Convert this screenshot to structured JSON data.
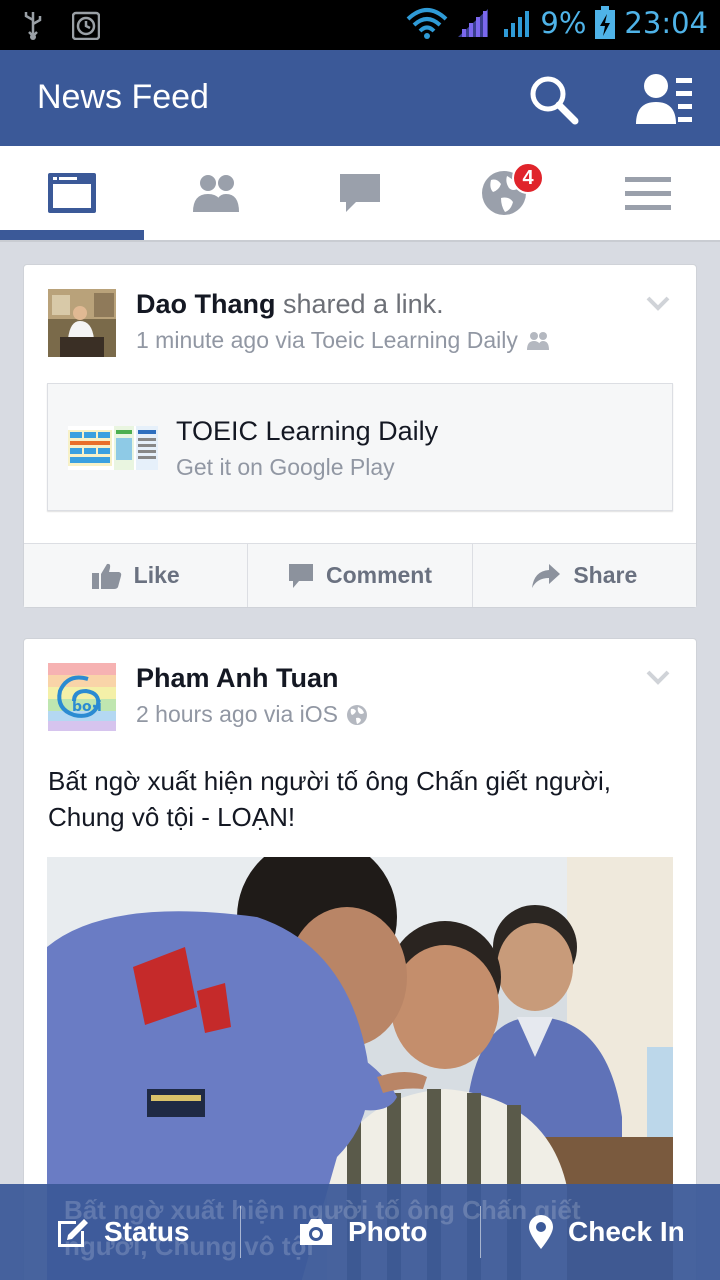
{
  "status_bar": {
    "battery_percent": "9%",
    "time": "23:04",
    "icons": [
      "usb-icon",
      "alarm-icon",
      "wifi-icon",
      "signal-icon",
      "signal-icon",
      "battery-charging-icon"
    ]
  },
  "app_bar": {
    "title": "News Feed",
    "icons": [
      "search-icon",
      "friend-requests-icon"
    ],
    "color": "#3b5998"
  },
  "tabs": [
    {
      "name": "news-feed",
      "icon": "news-feed-icon",
      "selected": true
    },
    {
      "name": "friends",
      "icon": "friends-icon"
    },
    {
      "name": "messages",
      "icon": "chat-bubble-icon"
    },
    {
      "name": "notifications",
      "icon": "globe-icon",
      "badge": "4"
    },
    {
      "name": "more",
      "icon": "menu-icon"
    }
  ],
  "posts": [
    {
      "author": "Dao Thang",
      "action": " shared a link.",
      "meta": "1 minute ago via Toeic Learning Daily",
      "privacy_icon": "friends-icon",
      "link": {
        "title": "TOEIC Learning Daily",
        "subtitle": "Get it on Google Play"
      },
      "actions": {
        "like": "Like",
        "comment": "Comment",
        "share": "Share"
      }
    },
    {
      "author": "Pham Anh Tuan",
      "meta": "2 hours ago via iOS",
      "privacy_icon": "globe-icon",
      "text": "Bất ngờ xuất hiện người tố ông Chấn giết người, Chung vô tội - LOẠN!"
    }
  ],
  "composer": {
    "status": "Status",
    "photo": "Photo",
    "check_in": "Check In",
    "behind_text": "Bất ngờ xuất hiện người tố ông Chấn giết người, Chung vô tội"
  }
}
